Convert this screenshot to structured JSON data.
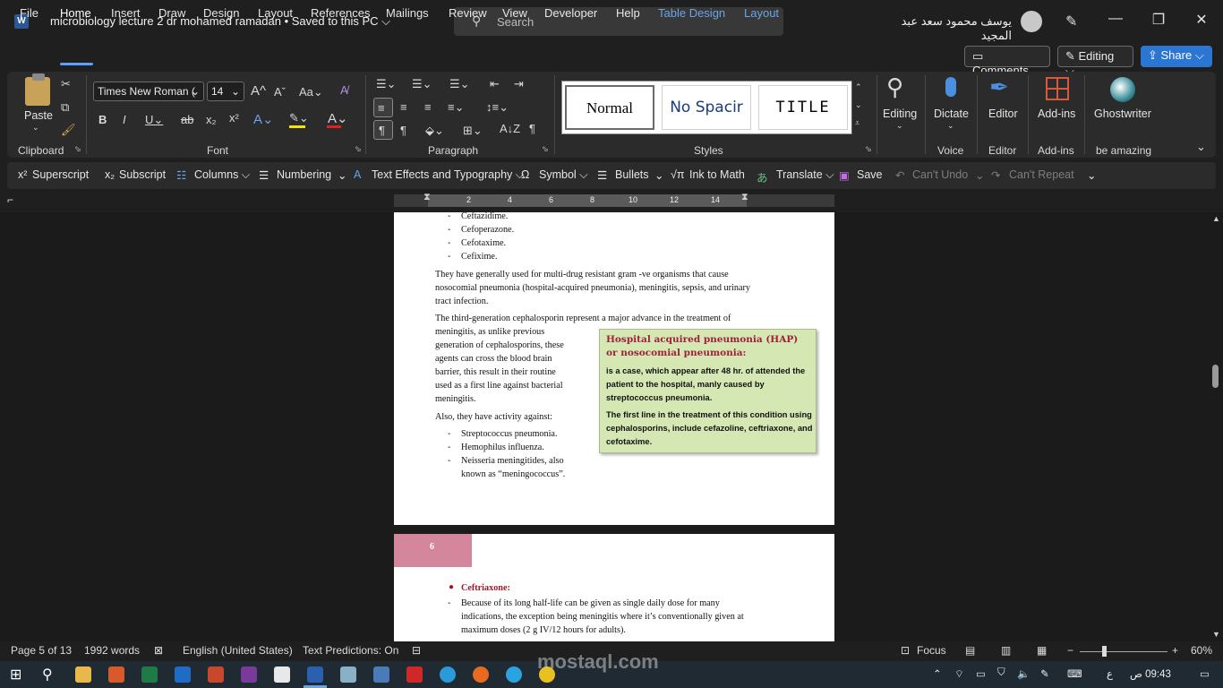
{
  "app": {
    "doc_title": "microbiology lecture 2 dr mohamed ramadan • Saved to this PC ⌵",
    "search_placeholder": "Search",
    "user_name": "يوسف محمود سعد عبد المجيد"
  },
  "menu": {
    "items": [
      "File",
      "Home",
      "Insert",
      "Draw",
      "Design",
      "Layout",
      "References",
      "Mailings",
      "Review",
      "View",
      "Developer",
      "Help",
      "Table Design",
      "Layout"
    ],
    "comments": "Comments",
    "editing": "Editing ⌵",
    "share": "Share ⌵"
  },
  "ribbon": {
    "clipboard": {
      "paste": "Paste",
      "label": "Clipboard"
    },
    "font": {
      "family": "Times New Roman (",
      "size": "14",
      "label": "Font"
    },
    "paragraph": {
      "label": "Paragraph"
    },
    "styles": {
      "items": [
        "Normal",
        "No Spacir",
        "TITLE"
      ],
      "label": "Styles"
    },
    "editing": {
      "btn": "Editing"
    },
    "voice": {
      "btn": "Dictate",
      "label": "Voice"
    },
    "editor": {
      "btn": "Editor",
      "label": "Editor"
    },
    "addins": {
      "btn": "Add-ins",
      "label": "Add-ins"
    },
    "ghostwriter": {
      "btn": "Ghostwriter",
      "label": "be amazing"
    }
  },
  "qat": {
    "superscript": "Superscript",
    "subscript": "Subscript",
    "columns": "Columns ⌵",
    "numbering": "Numbering",
    "text_effects": "Text Effects and Typography ⌵",
    "symbol": "Symbol ⌵",
    "bullets": "Bullets",
    "ink_to_math": "Ink to Math",
    "translate": "Translate ⌵",
    "save": "Save",
    "cant_undo": "Can't Undo",
    "cant_repeat": "Can't Repeat"
  },
  "ruler": {
    "ticks": [
      "2",
      "4",
      "6",
      "8",
      "10",
      "12",
      "14"
    ]
  },
  "page5": {
    "list_top": [
      "Ceftazidime.",
      "Cefoperazone.",
      "Cefotaxime.",
      "Cefixime."
    ],
    "para1": [
      "They have generally used for multi-drug resistant gram -ve organisms that cause",
      "nosocomial pneumonia (hospital-acquired pneumonia), meningitis, sepsis, and urinary",
      "tract infection."
    ],
    "para2_first": "The third-generation cephalosporin represent a major advance in the treatment of",
    "para2_wrap": [
      "meningitis, as unlike previous",
      "generation of cephalosporins, these",
      "agents can cross the blood brain",
      "barrier, this result in their routine",
      "used as a first line against bacterial",
      "meningitis."
    ],
    "also": "Also, they have activity against:",
    "list_bottom": [
      "Streptococcus pneumonia.",
      "Hemophilus influenza.",
      "Neisseria meningitides, also",
      "known as “meningococcus”."
    ],
    "callout": {
      "title": "Hospital acquired pneumonia (HAP) or nosocomial pneumonia:",
      "para1": "is a case, which appear after 48 hr. of attended the patient to the hospital, manly caused by streptococcus pneumonia.",
      "para2": "The first line in the treatment of this condition using cephalosporins, include cefazoline, ceftriaxone, and cefotaxime."
    }
  },
  "page6": {
    "page_number": "6",
    "bullet_title": "Ceftriaxone:",
    "lines": [
      "Because of its long half-life can be given as single daily dose for many",
      "indications, the exception being meningitis where it’s conventionally given at",
      "maximum doses (2 g IV/12 hours for adults)."
    ]
  },
  "status": {
    "page": "Page 5 of 13",
    "words": "1992 words",
    "language": "English (United States)",
    "predictions": "Text Predictions: On",
    "focus": "Focus",
    "zoom": "60%"
  },
  "taskbar": {
    "time": "09:43 ص",
    "lang": "ع",
    "watermark": "mostaql.com"
  },
  "colors": {
    "accent": "#2b76d3",
    "page_number_bg": "#d4869c",
    "callout_bg": "#d5e8b4",
    "callout_title": "#a0203a",
    "ceftriaxone_red": "#a01828"
  }
}
